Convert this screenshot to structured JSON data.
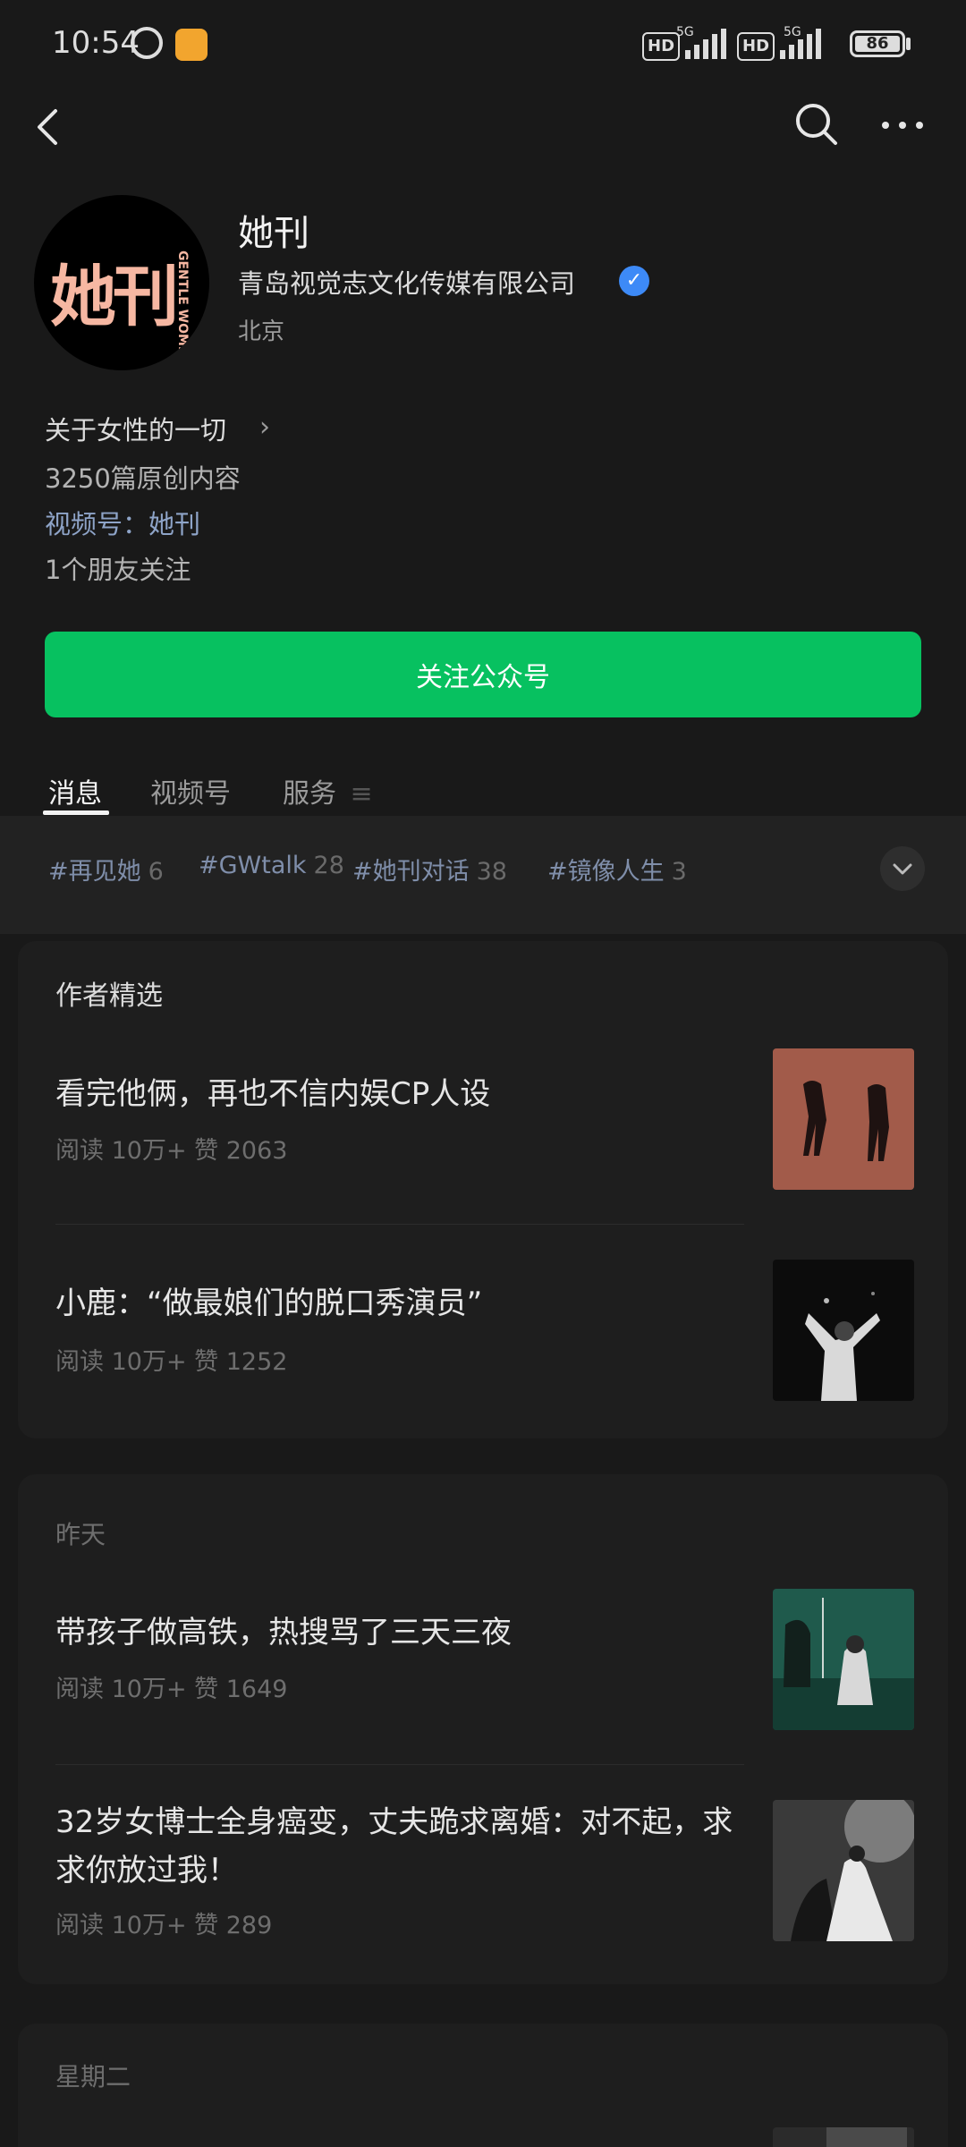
{
  "status_bar": {
    "time": "10:54",
    "network_1": "HD",
    "network_1_gen": "5G",
    "network_2": "HD",
    "network_2_gen": "5G",
    "battery": "86"
  },
  "profile": {
    "logo_text": "她刊",
    "logo_sub": "GENTLE WOMEN",
    "name": "她刊",
    "company": "青岛视觉志文化传媒有限公司",
    "city": "北京",
    "intro": "关于女性的一切",
    "article_count": "3250篇原创内容",
    "video_channel": "视频号：她刊",
    "friends": "1个朋友关注",
    "follow_label": "关注公众号"
  },
  "tabs": [
    {
      "label": "消息"
    },
    {
      "label": "视频号"
    },
    {
      "label": "服务"
    }
  ],
  "tags": [
    {
      "label": "#再见她",
      "count": "6"
    },
    {
      "label": "#GWtalk",
      "count": "28"
    },
    {
      "label": "#她刊对话",
      "count": "38"
    },
    {
      "label": "#镜像人生",
      "count": "3"
    }
  ],
  "featured": {
    "title": "作者精选",
    "articles": [
      {
        "title": "看完他俩，再也不信内娱CP人设",
        "meta": "阅读 10万+  赞 2063"
      },
      {
        "title": "小鹿：“做最娘们的脱口秀演员”",
        "meta": "阅读 10万+  赞 1252"
      }
    ]
  },
  "yesterday": {
    "date": "昨天",
    "articles": [
      {
        "title": "带孩子做高铁，热搜骂了三天三夜",
        "meta": "阅读 10万+  赞 1649"
      },
      {
        "title": "32岁女博士全身癌变，丈夫跪求离婚：对不起，求求你放过我！",
        "meta": "阅读 10万+  赞 289"
      }
    ]
  },
  "tuesday": {
    "date": "星期二"
  },
  "colors": {
    "background": "#191919",
    "follow_button": "#07c160",
    "verified": "#3d8af7",
    "channel_link": "#8ea4c8"
  }
}
